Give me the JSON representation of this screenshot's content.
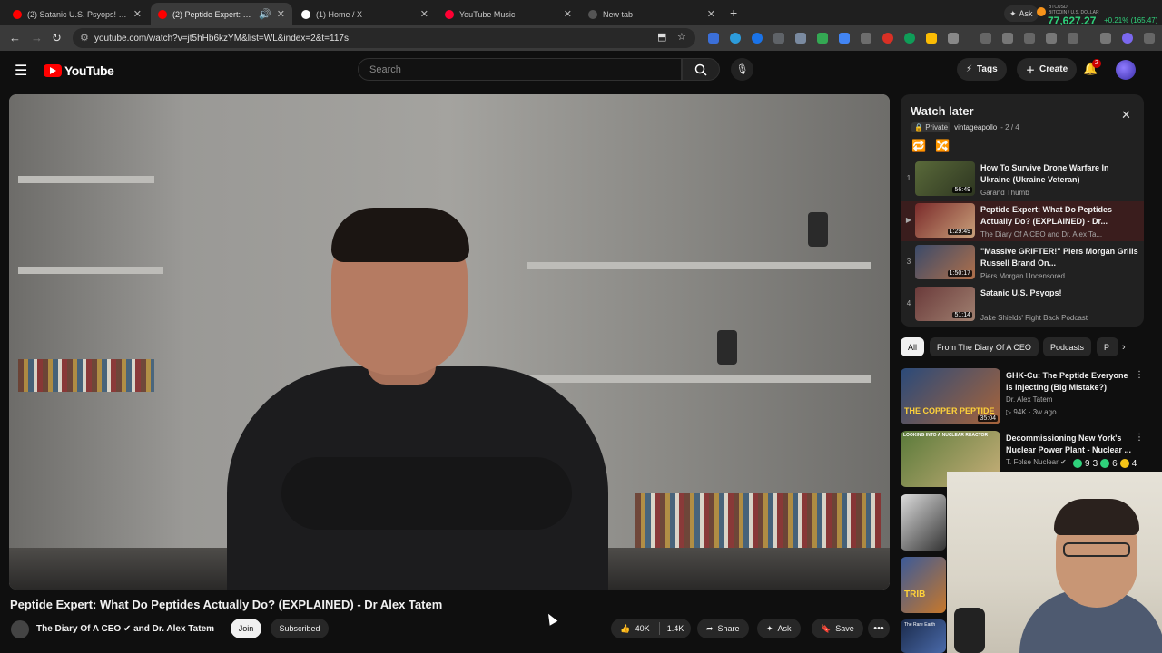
{
  "browser": {
    "tabs": [
      {
        "title": "(2) Satanic U.S. Psyops! - YouTube",
        "favicon_color": "#ff0000",
        "active": false
      },
      {
        "title": "(2) Peptide Expert: What Do Peptides",
        "favicon_color": "#ff0000",
        "active": true
      },
      {
        "title": "(1) Home / X",
        "favicon_color": "#ffffff",
        "active": false
      },
      {
        "title": "YouTube Music",
        "favicon_color": "#ff0033",
        "active": false
      },
      {
        "title": "New tab",
        "favicon_color": "#555555",
        "active": false
      }
    ],
    "url": "youtube.com/watch?v=jt5hHb6kzYM&list=WL&index=2&t=117s",
    "ticker": {
      "ask_label": "Ask",
      "symbol": "BTCUSD",
      "symbol_sub": "BITCOIN / U.S. DOLLAR",
      "price": "77,627.27",
      "change": "+0.21% (165.47)"
    }
  },
  "header": {
    "logo_text": "YouTube",
    "search_placeholder": "Search",
    "tags_label": "Tags",
    "create_label": "Create",
    "notification_count": "2"
  },
  "video": {
    "title": "Peptide Expert: What Do Peptides Actually Do? (EXPLAINED) - Dr Alex Tatem",
    "channel": "The Diary Of A CEO ✔ and Dr. Alex Tatem",
    "join_label": "Join",
    "subscribed_label": "Subscribed",
    "likes": "40K",
    "dislikes": "1.4K",
    "share_label": "Share",
    "ask_label": "Ask",
    "save_label": "Save"
  },
  "watch_later": {
    "title": "Watch later",
    "privacy": "Private",
    "owner": "vintageapollo",
    "position": "- 2 / 4",
    "items": [
      {
        "index": "1",
        "title": "How To Survive Drone Warfare In Ukraine (Ukraine Veteran)",
        "channel": "Garand Thumb",
        "duration": "56:49",
        "current": false
      },
      {
        "index": "▶",
        "title": "Peptide Expert: What Do Peptides Actually Do? (EXPLAINED) - Dr...",
        "channel": "The Diary Of A CEO and Dr. Alex Ta...",
        "duration": "1:29:49",
        "current": true
      },
      {
        "index": "3",
        "title": "\"Massive GRIFTER!\" Piers Morgan Grills Russell Brand On...",
        "channel": "Piers Morgan Uncensored",
        "duration": "1:50:17",
        "current": false
      },
      {
        "index": "4",
        "title": "Satanic U.S. Psyops!",
        "channel": "Jake Shields' Fight Back Podcast",
        "duration": "51:14",
        "current": false
      }
    ]
  },
  "chips": [
    "All",
    "From The Diary Of A CEO",
    "Podcasts",
    "P"
  ],
  "recommendations": [
    {
      "title": "GHK-Cu: The Peptide Everyone Is Injecting (Big Mistake?)",
      "channel": "Dr. Alex Tatem",
      "meta": "94K · 3w ago",
      "duration": "35:04",
      "thumb_text": "THE COPPER PEPTIDE"
    },
    {
      "title": "Decommissioning New York's Nuclear Power Plant - Nuclear ...",
      "channel": "T. Folse Nuclear ✔",
      "meta": "",
      "duration": "",
      "thumb_text": "LOOKING INTO A NUCLEAR REACTOR"
    }
  ],
  "mini_thumbs": [
    "",
    "TRIB",
    "The Rare Earth"
  ],
  "overlay_ticker": [
    "9",
    "3",
    "6",
    "4"
  ],
  "colors": {
    "accent": "#ff0000",
    "up": "#2fd17b",
    "current_item_bg": "#3a1d1d"
  }
}
